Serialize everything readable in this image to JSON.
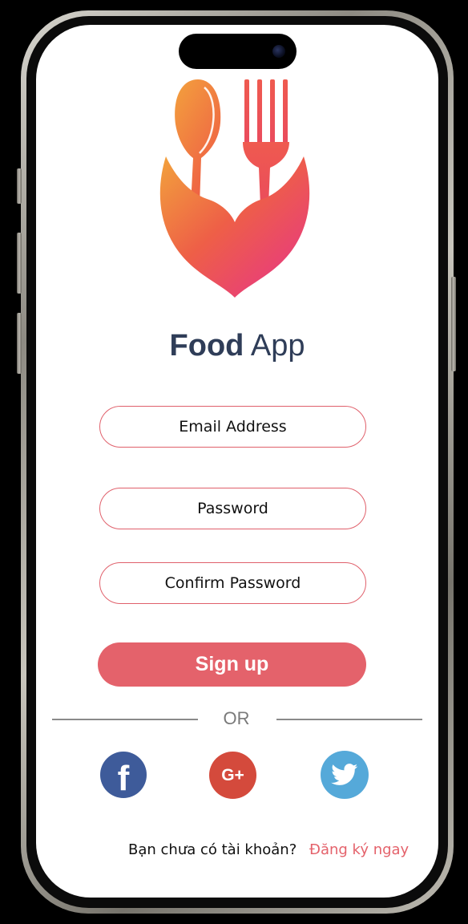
{
  "app": {
    "title_bold": "Food",
    "title_regular": " App"
  },
  "form": {
    "email_placeholder": "Email Address",
    "password_placeholder": "Password",
    "confirm_placeholder": "Confirm Password",
    "signup_label": "Sign up"
  },
  "divider": {
    "label": "OR"
  },
  "social": {
    "facebook_glyph": "f",
    "google_glyph": "G+",
    "twitter_icon": "twitter-bird-icon"
  },
  "footer": {
    "question": "Bạn chưa có tài khoản?",
    "signup_link": "Đăng ký ngay"
  },
  "colors": {
    "accent": "#e4626b",
    "title": "#2f3d58",
    "facebook": "#3e5b9a",
    "google": "#d44a3c",
    "twitter": "#55a9d9"
  }
}
